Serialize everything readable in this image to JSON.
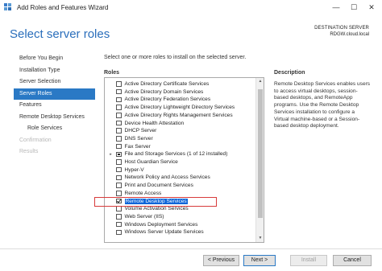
{
  "window": {
    "title": "Add Roles and Features Wizard",
    "controls": {
      "minimize": "—",
      "maximize": "☐",
      "close": "✕"
    }
  },
  "header": {
    "page_title": "Select server roles",
    "destination_label": "DESTINATION SERVER",
    "destination_server": "RDGW.cloud.local"
  },
  "nav": [
    {
      "label": "Before You Begin",
      "state": "normal"
    },
    {
      "label": "Installation Type",
      "state": "normal"
    },
    {
      "label": "Server Selection",
      "state": "normal"
    },
    {
      "label": "Server Roles",
      "state": "active"
    },
    {
      "label": "Features",
      "state": "normal"
    },
    {
      "label": "Remote Desktop Services",
      "state": "normal"
    },
    {
      "label": "Role Services",
      "state": "sub"
    },
    {
      "label": "Confirmation",
      "state": "disabled"
    },
    {
      "label": "Results",
      "state": "disabled"
    }
  ],
  "main": {
    "instruction": "Select one or more roles to install on the selected server.",
    "roles_label": "Roles",
    "description_label": "Description",
    "description_text": "Remote Desktop Services enables users to access virtual desktops, session-based desktops, and RemoteApp programs. Use the Remote Desktop Services installation to configure a Virtual machine-based or a Session-based desktop deployment."
  },
  "roles": [
    {
      "label": "Active Directory Certificate Services",
      "checked": "none",
      "expander": ""
    },
    {
      "label": "Active Directory Domain Services",
      "checked": "none",
      "expander": ""
    },
    {
      "label": "Active Directory Federation Services",
      "checked": "none",
      "expander": ""
    },
    {
      "label": "Active Directory Lightweight Directory Services",
      "checked": "none",
      "expander": ""
    },
    {
      "label": "Active Directory Rights Management Services",
      "checked": "none",
      "expander": ""
    },
    {
      "label": "Device Health Attestation",
      "checked": "none",
      "expander": ""
    },
    {
      "label": "DHCP Server",
      "checked": "none",
      "expander": ""
    },
    {
      "label": "DNS Server",
      "checked": "none",
      "expander": ""
    },
    {
      "label": "Fax Server",
      "checked": "none",
      "expander": ""
    },
    {
      "label": "File and Storage Services (1 of 12 installed)",
      "checked": "partial",
      "expander": "▸"
    },
    {
      "label": "Host Guardian Service",
      "checked": "none",
      "expander": ""
    },
    {
      "label": "Hyper-V",
      "checked": "none",
      "expander": ""
    },
    {
      "label": "Network Policy and Access Services",
      "checked": "none",
      "expander": ""
    },
    {
      "label": "Print and Document Services",
      "checked": "none",
      "expander": ""
    },
    {
      "label": "Remote Access",
      "checked": "none",
      "expander": ""
    },
    {
      "label": "Remote Desktop Services",
      "checked": "checked",
      "expander": "",
      "selected": true
    },
    {
      "label": "Volume Activation Services",
      "checked": "none",
      "expander": ""
    },
    {
      "label": "Web Server (IIS)",
      "checked": "none",
      "expander": ""
    },
    {
      "label": "Windows Deployment Services",
      "checked": "none",
      "expander": ""
    },
    {
      "label": "Windows Server Update Services",
      "checked": "none",
      "expander": ""
    }
  ],
  "scrollbar": {
    "up_glyph": "▲",
    "down_glyph": "▼"
  },
  "buttons": {
    "previous": "< Previous",
    "next": "Next >",
    "install": "Install",
    "cancel": "Cancel"
  }
}
